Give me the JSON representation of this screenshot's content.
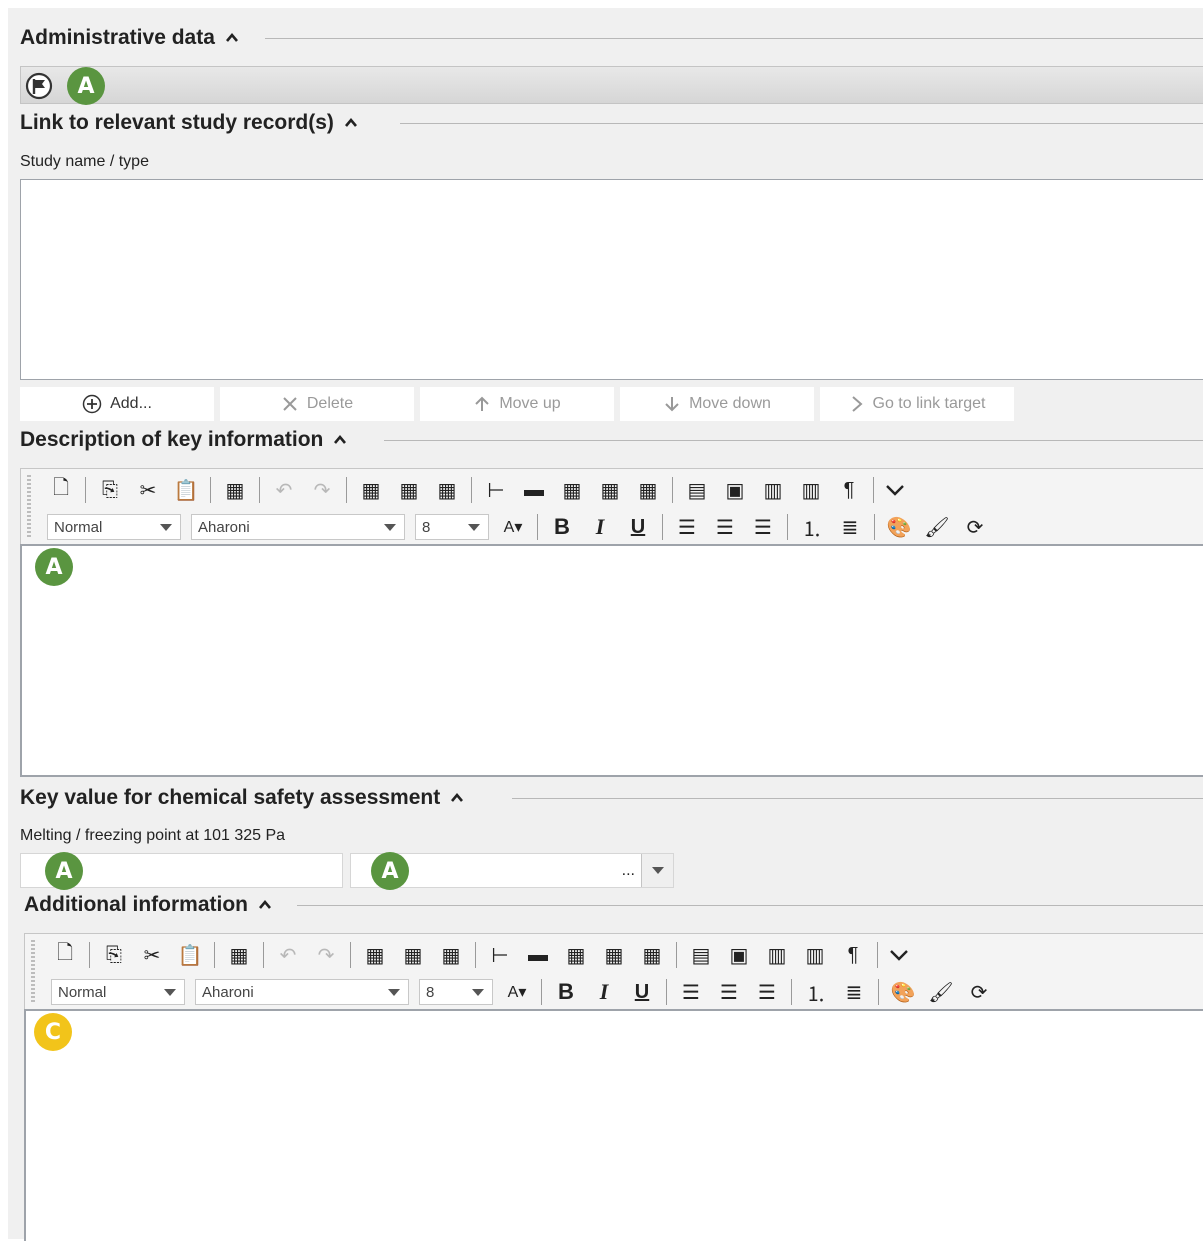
{
  "sections": {
    "admin": {
      "title": "Administrative data"
    },
    "link": {
      "title": "Link to relevant study record(s)",
      "field_label": "Study name / type",
      "buttons": {
        "add": "Add...",
        "delete": "Delete",
        "move_up": "Move up",
        "move_down": "Move down",
        "go_to": "Go to link target"
      }
    },
    "description": {
      "title": "Description of key information"
    },
    "key_value": {
      "title": "Key value for chemical safety assessment",
      "field_label": "Melting / freezing point at 101 325 Pa",
      "unit_value": "..."
    },
    "additional": {
      "title": "Additional information"
    }
  },
  "editor": {
    "style": "Normal",
    "font": "Aharoni",
    "size": "8",
    "bold": "B",
    "italic": "I",
    "underline": "U",
    "pilcrow": "¶"
  },
  "badges": {
    "a": "A",
    "c": "C"
  },
  "colors": {
    "badge_green": "#5a9540",
    "badge_yellow": "#f2c41a",
    "panel_bg": "#f0f0f0"
  }
}
